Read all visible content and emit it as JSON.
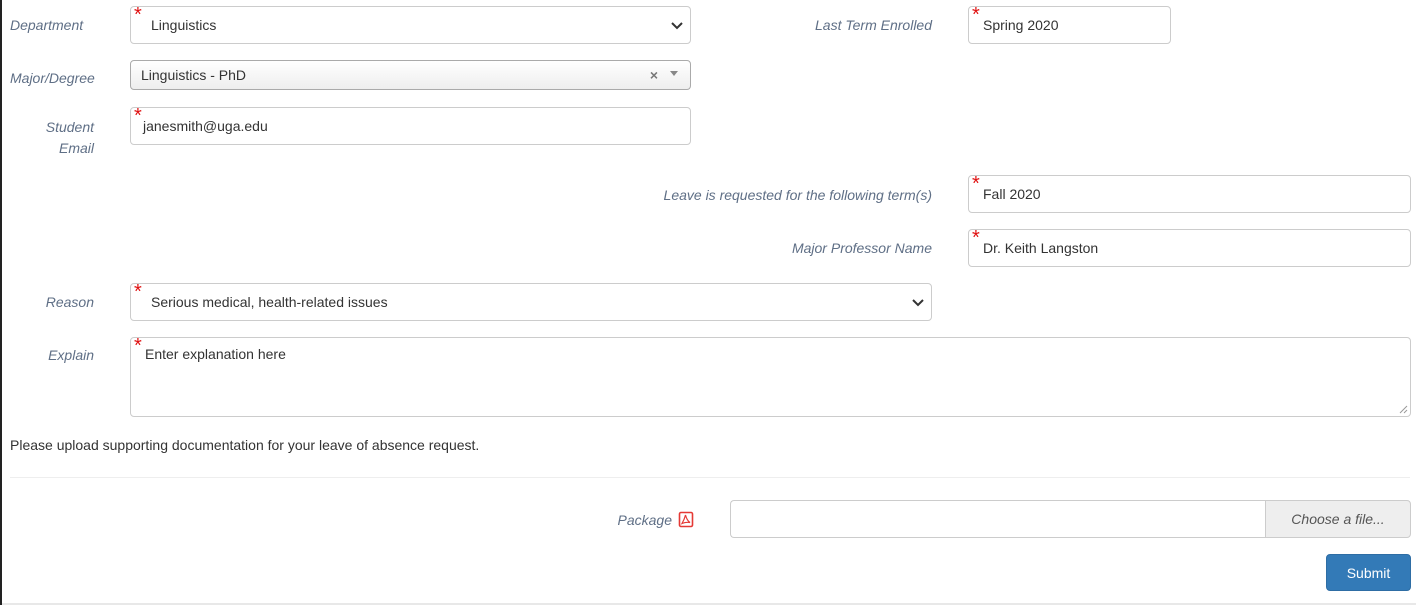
{
  "form": {
    "department": {
      "label": "Department",
      "value": "Linguistics"
    },
    "last_term": {
      "label": "Last Term Enrolled",
      "value": "Spring 2020"
    },
    "major": {
      "label": "Major/Degree",
      "value": "Linguistics - PhD",
      "clear": "×"
    },
    "student_email": {
      "label_line1": "Student",
      "label_line2": "Email",
      "value": "janesmith@uga.edu"
    },
    "leave_term": {
      "label": "Leave is requested for the following term(s)",
      "value": "Fall 2020"
    },
    "major_professor": {
      "label": "Major Professor Name",
      "value": "Dr. Keith Langston"
    },
    "reason": {
      "label": "Reason",
      "value": "Serious medical, health-related issues"
    },
    "explain": {
      "label": "Explain",
      "placeholder": "Enter explanation here"
    },
    "required_marker": "*"
  },
  "upload": {
    "instructions": "Please upload supporting documentation for your leave of absence request.",
    "package_label": "Package",
    "choose_file_label": "Choose a file..."
  },
  "actions": {
    "submit_label": "Submit"
  },
  "colors": {
    "label": "#5f6f86",
    "required": "#e01010",
    "primary": "#337ab7",
    "pdf_icon": "#e53935"
  }
}
